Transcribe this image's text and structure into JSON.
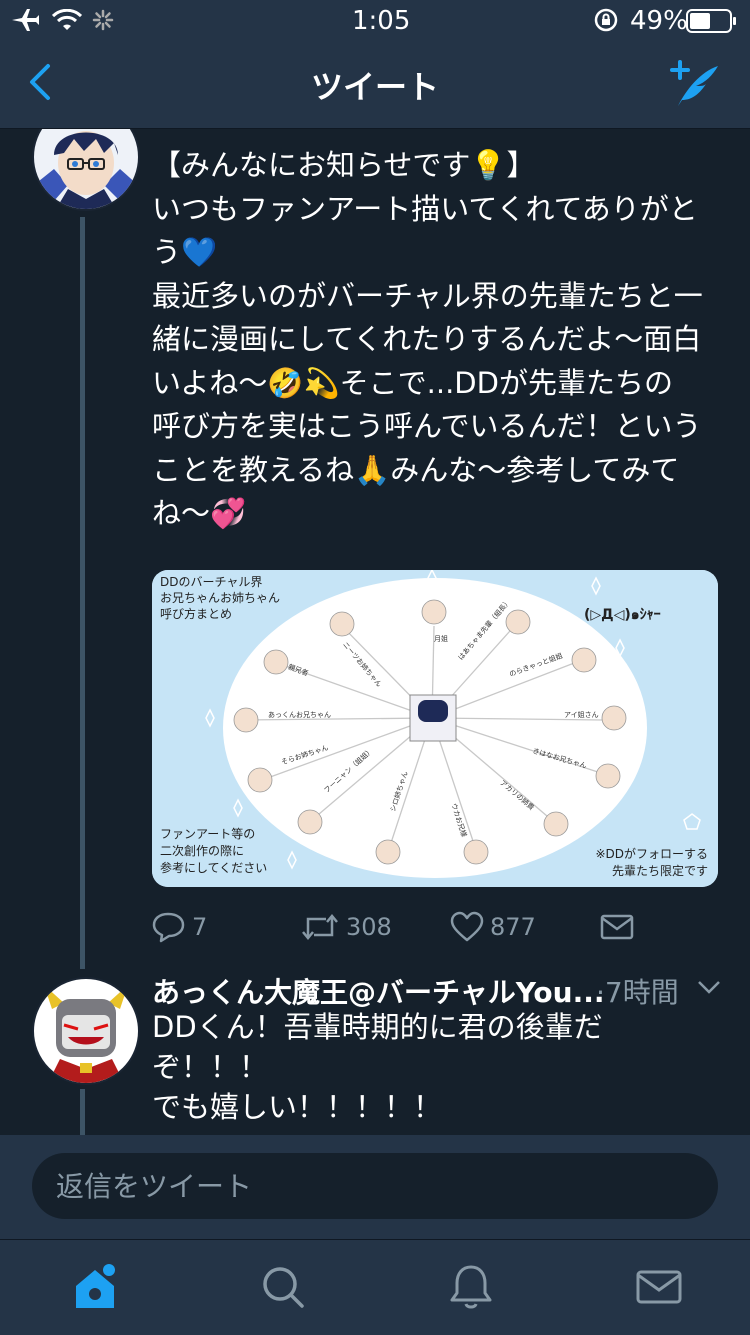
{
  "status_bar": {
    "time": "1:05",
    "battery": "49%"
  },
  "nav": {
    "title": "ツイート"
  },
  "tweet": {
    "lines": [
      "【みんなにお知らせです💡】",
      "いつもファンアート描いてくれてありがと",
      "う💙",
      "最近多いのがバーチャル界の先輩たちと一",
      "緒に漫画にしてくれたりするんだよ〜面白",
      "いよね〜🤣💫そこで...DDが先輩たちの",
      "呼び方を実はこう呼んでいるんだ！という",
      "ことを教えるね🙏みんな〜参考してみて",
      "ね〜💞"
    ],
    "replies": "7",
    "retweets": "308",
    "likes": "877"
  },
  "media": {
    "title": [
      "DDのバーチャル界",
      "お兄ちゃんお姉ちゃん",
      "呼び方まとめ"
    ],
    "signature": "(▷Д◁)๑ｼｬｰ",
    "bottom_left": [
      "ファンアート等の",
      "二次創作の際に",
      "参考にしてください"
    ],
    "bottom_right": [
      "※DDがフォローする",
      "先輩たち限定です"
    ],
    "labels": [
      "月姐",
      "はあちゃま先輩（組長）",
      "のらきゃっと姐姐",
      "アイ姐さん",
      "きはなお兄ちゃん",
      "アカリの姉貴",
      "ウカお兄様",
      "シロ姉ちゃん",
      "フーニャン（姐姐）",
      "そらお姉ちゃん",
      "あっくんお兄ちゃん",
      "親兄者",
      "ニーツお姉ちゃん"
    ]
  },
  "reply": {
    "name": "あっくん大魔王@バーチャルYou...",
    "time": "·7時間",
    "lines": [
      "DDくん！吾輩時期的に君の後輩だ",
      "ぞ！！！",
      "でも嬉しい！！！！！"
    ]
  },
  "reply_bar": {
    "placeholder": "返信をツイート"
  },
  "colors": {
    "background": "#15202b",
    "bar": "#243447",
    "accent": "#1da1f2",
    "muted": "#8899a6"
  },
  "icons": {
    "status": [
      "airplane-icon",
      "wifi-icon",
      "loading-icon",
      "orientation-lock-icon",
      "battery-icon"
    ],
    "nav": [
      "back-icon",
      "compose-icon"
    ],
    "actions": [
      "reply-icon",
      "retweet-icon",
      "like-icon",
      "dm-icon"
    ],
    "tabs": [
      "home-icon",
      "search-icon",
      "notifications-icon",
      "messages-icon"
    ]
  }
}
